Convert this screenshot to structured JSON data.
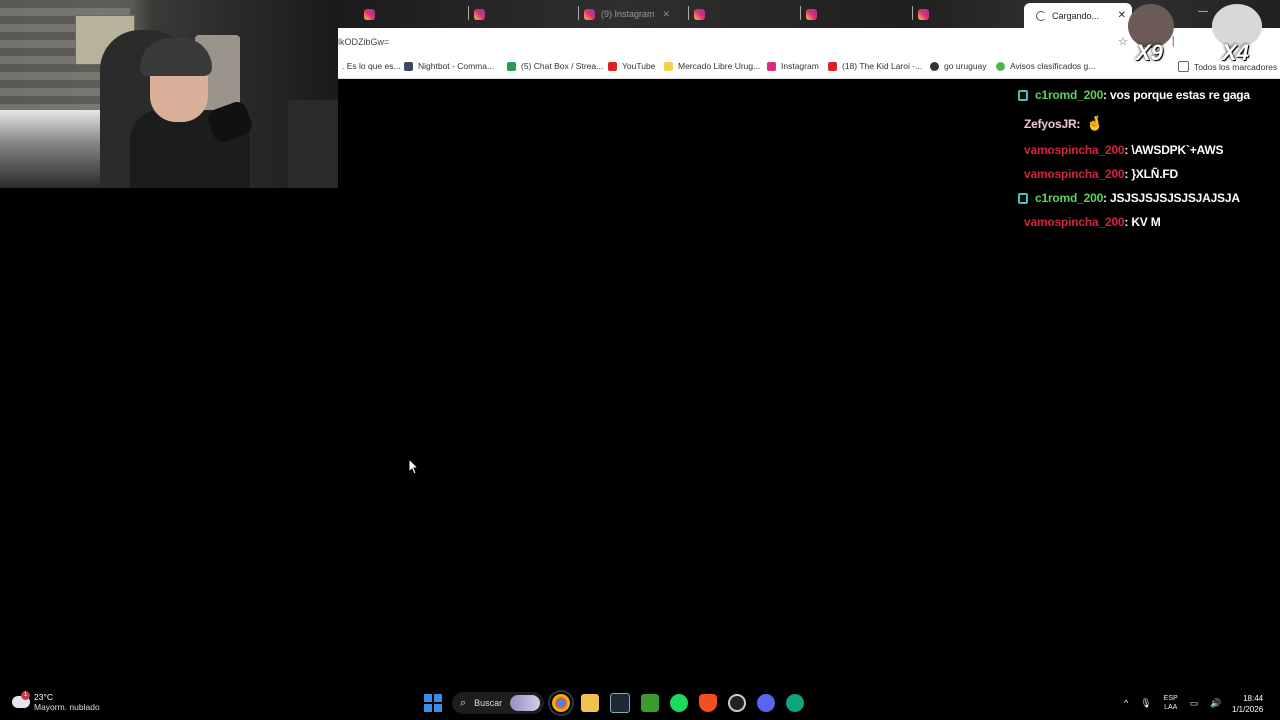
{
  "browser": {
    "tabs": [
      {
        "label": ""
      },
      {
        "label": ""
      },
      {
        "label": "(9) Instagram"
      },
      {
        "label": ""
      },
      {
        "label": ""
      },
      {
        "label": ""
      }
    ],
    "active_tab": {
      "label": "Cargando...",
      "close": "✕"
    },
    "window_min": "—",
    "url": "lkODZibGw=",
    "bookmarks": [
      {
        "label": ". Es lo que es...",
        "color": "#888888"
      },
      {
        "label": "Nightbot - Comma...",
        "color": "#3b4a5e"
      },
      {
        "label": "(5) Chat Box / Strea...",
        "color": "#2a9a5a"
      },
      {
        "label": "YouTube",
        "color": "#e02020"
      },
      {
        "label": "Mercado Libre Urug...",
        "color": "#f2d14a"
      },
      {
        "label": "Instagram",
        "color": "#d6307a"
      },
      {
        "label": "(18) The Kid Laroi -...",
        "color": "#e02020"
      },
      {
        "label": "go uruguay",
        "color": "#333333"
      },
      {
        "label": "Avisos clasificados g...",
        "color": "#4cb84c"
      },
      {
        "label": "Todos los marcadores",
        "color": "#666666"
      }
    ]
  },
  "stickers": {
    "left": "X9",
    "right": "X4"
  },
  "chat": {
    "messages": [
      {
        "user": "c1romd_200",
        "text": ": vos porque estas re gaga",
        "color": "green",
        "badge": true
      },
      {
        "user": "ZefyosJR",
        "text": ":",
        "color": "pink",
        "badge": false,
        "emote": "🤞"
      },
      {
        "user": "vamospincha_200",
        "text": ": \\AWSDPK`+AWS",
        "color": "red",
        "badge": false
      },
      {
        "user": "vamospincha_200",
        "text": ": }XLÑ.FD",
        "color": "red",
        "badge": false
      },
      {
        "user": "c1romd_200",
        "text": ": JSJSJSJSJSJSJAJSJA",
        "color": "green",
        "badge": true
      },
      {
        "user": "vamospincha_200",
        "text": ": KV M",
        "color": "red",
        "badge": false
      }
    ]
  },
  "taskbar": {
    "weather": {
      "temp": "23°C",
      "desc": "Mayorm. nublado",
      "alert": "1"
    },
    "search_label": "Buscar",
    "apps": [
      "chrome-icon",
      "file-explorer-icon",
      "steam-icon",
      "minecraft-icon",
      "spotify-icon",
      "brave-icon",
      "obs-icon",
      "discord-icon",
      "chatgpt-icon"
    ],
    "tray": {
      "lang_top": "ESP",
      "lang_bottom": "LAA",
      "chevron": "^"
    },
    "clock": {
      "time": "18:44",
      "date": "1/1/2026"
    }
  }
}
